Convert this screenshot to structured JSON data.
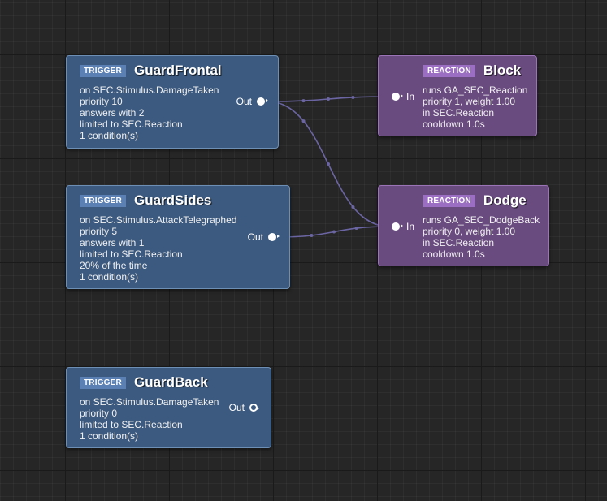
{
  "colors": {
    "background": "#262626",
    "trigger_fill": "#3c5a7f",
    "trigger_border": "#6d8fb6",
    "trigger_tag": "#5b80b4",
    "reaction_fill": "#6a4b80",
    "reaction_border": "#9a74b6",
    "reaction_tag": "#9b6ec3",
    "wire": "#6b65a3"
  },
  "triggers": [
    {
      "tag": "TRIGGER",
      "title": "GuardFrontal",
      "lines": [
        "on SEC.Stimulus.DamageTaken",
        "priority 10",
        "answers with 2",
        "limited to SEC.Reaction",
        "1 condition(s)"
      ],
      "out_label": "Out",
      "out_connected": true
    },
    {
      "tag": "TRIGGER",
      "title": "GuardSides",
      "lines": [
        "on SEC.Stimulus.AttackTelegraphed",
        "priority 5",
        "answers with 1",
        "limited to SEC.Reaction",
        "20% of the time",
        "1 condition(s)"
      ],
      "out_label": "Out",
      "out_connected": true
    },
    {
      "tag": "TRIGGER",
      "title": "GuardBack",
      "lines": [
        "on SEC.Stimulus.DamageTaken",
        "priority 0",
        "limited to SEC.Reaction",
        "1 condition(s)"
      ],
      "out_label": "Out",
      "out_connected": false
    }
  ],
  "reactions": [
    {
      "tag": "REACTION",
      "title": "Block",
      "lines": [
        "runs GA_SEC_Reaction",
        "priority 1, weight 1.00",
        "in SEC.Reaction",
        "cooldown 1.0s"
      ],
      "in_label": "In"
    },
    {
      "tag": "REACTION",
      "title": "Dodge",
      "lines": [
        "runs GA_SEC_DodgeBack",
        "priority 0, weight 1.00",
        "in SEC.Reaction",
        "cooldown 1.0s"
      ],
      "in_label": "In"
    }
  ],
  "connections": [
    {
      "from": "GuardFrontal",
      "to": "Block"
    },
    {
      "from": "GuardFrontal",
      "to": "Dodge"
    },
    {
      "from": "GuardSides",
      "to": "Dodge"
    }
  ]
}
